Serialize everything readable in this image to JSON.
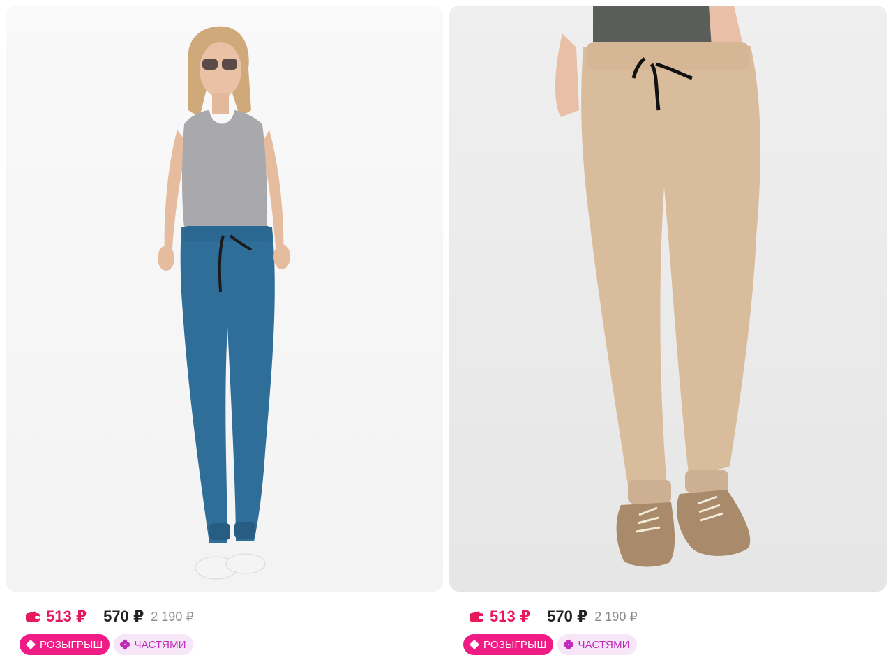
{
  "products": [
    {
      "image_alt": "Женские спортивные брюки джоггеры синие",
      "wallet_price": "513 ₽",
      "price": "570 ₽",
      "old_price": "2 190 ₽",
      "badges": {
        "raffle": "РОЗЫГРЫШ",
        "installments": "ЧАСТЯМИ"
      }
    },
    {
      "image_alt": "Женские спортивные брюки джоггеры бежевые",
      "wallet_price": "513 ₽",
      "price": "570 ₽",
      "old_price": "2 190 ₽",
      "badges": {
        "raffle": "РОЗЫГРЫШ",
        "installments": "ЧАСТЯМИ"
      }
    }
  ],
  "colors": {
    "wallet_price": "#e6195b",
    "raffle_badge": "#f01c86",
    "installments_badge_bg": "#f6e6f8",
    "installments_badge_text": "#c02bb9"
  },
  "icons": [
    "wallet-icon",
    "raffle-icon",
    "installments-icon"
  ]
}
